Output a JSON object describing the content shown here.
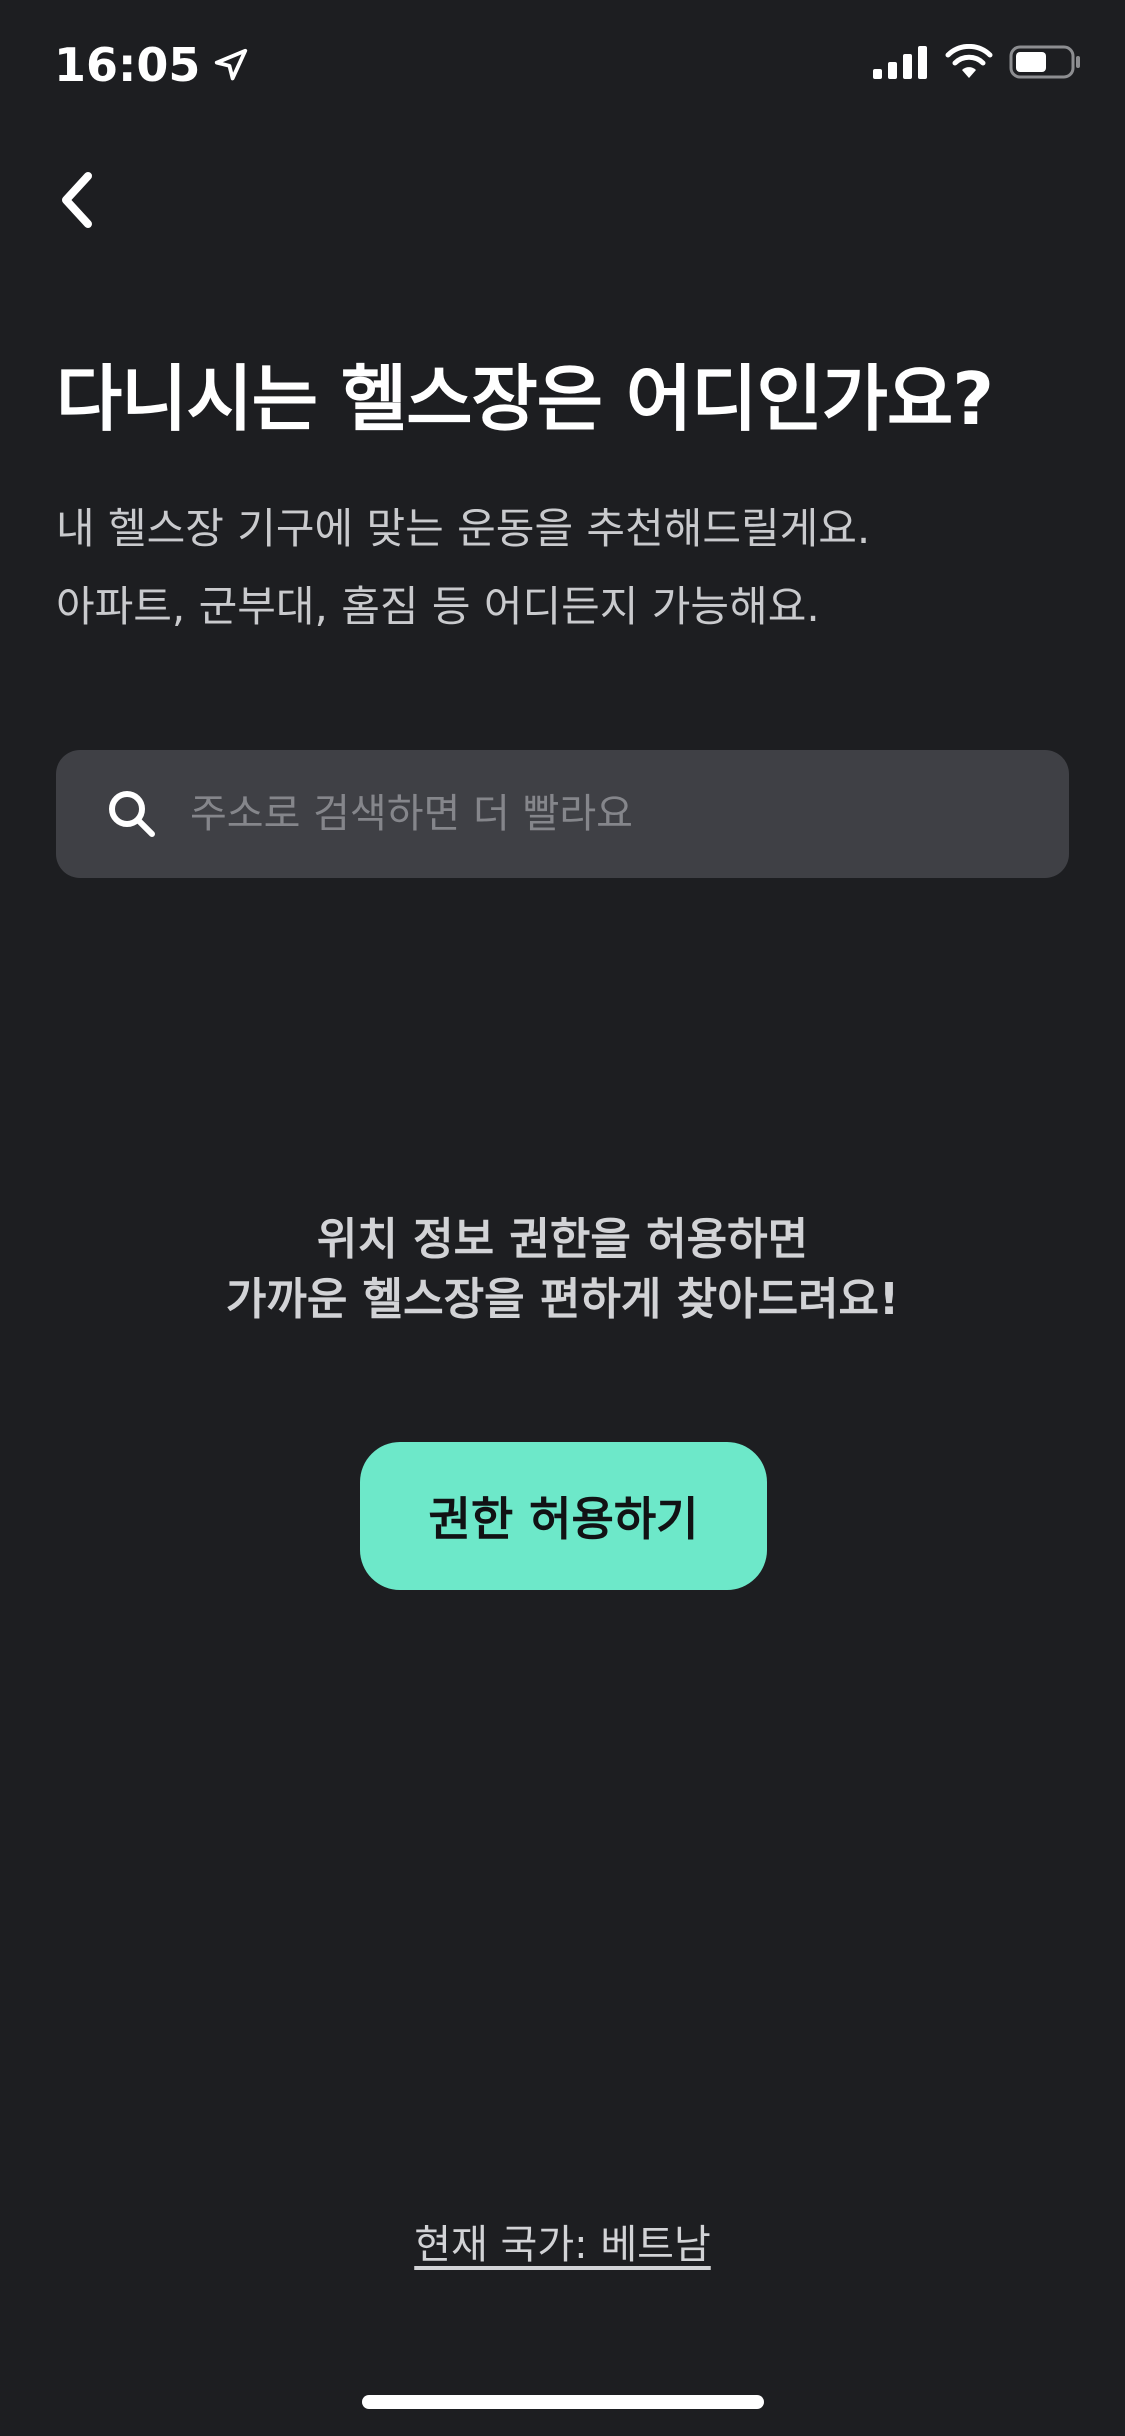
{
  "status_bar": {
    "time": "16:05",
    "icons": [
      "location-arrow-icon",
      "signal-icon",
      "wifi-icon",
      "battery-icon"
    ]
  },
  "nav": {
    "back_icon": "chevron-left-icon"
  },
  "header": {
    "title": "다니시는 헬스장은 어디인가요?",
    "subtitle_line1": "내 헬스장 기구에 맞는 운동을 추천해드릴게요.",
    "subtitle_line2": "아파트, 군부대, 홈짐 등 어디든지 가능해요."
  },
  "search": {
    "icon": "search-icon",
    "placeholder": "주소로 검색하면 더 빨라요",
    "value": ""
  },
  "permission": {
    "message_line1": "위치 정보 권한을 허용하면",
    "message_line2": "가까운 헬스장을 편하게 찾아드려요!",
    "button_label": "권한 허용하기"
  },
  "footer": {
    "country_label": "현재 국가: 베트남"
  },
  "colors": {
    "background": "#1d1e21",
    "search_bg": "#3f4045",
    "accent": "#6de8c9",
    "text_primary": "#ffffff",
    "text_secondary": "#c9cacd",
    "placeholder": "#85868b"
  }
}
